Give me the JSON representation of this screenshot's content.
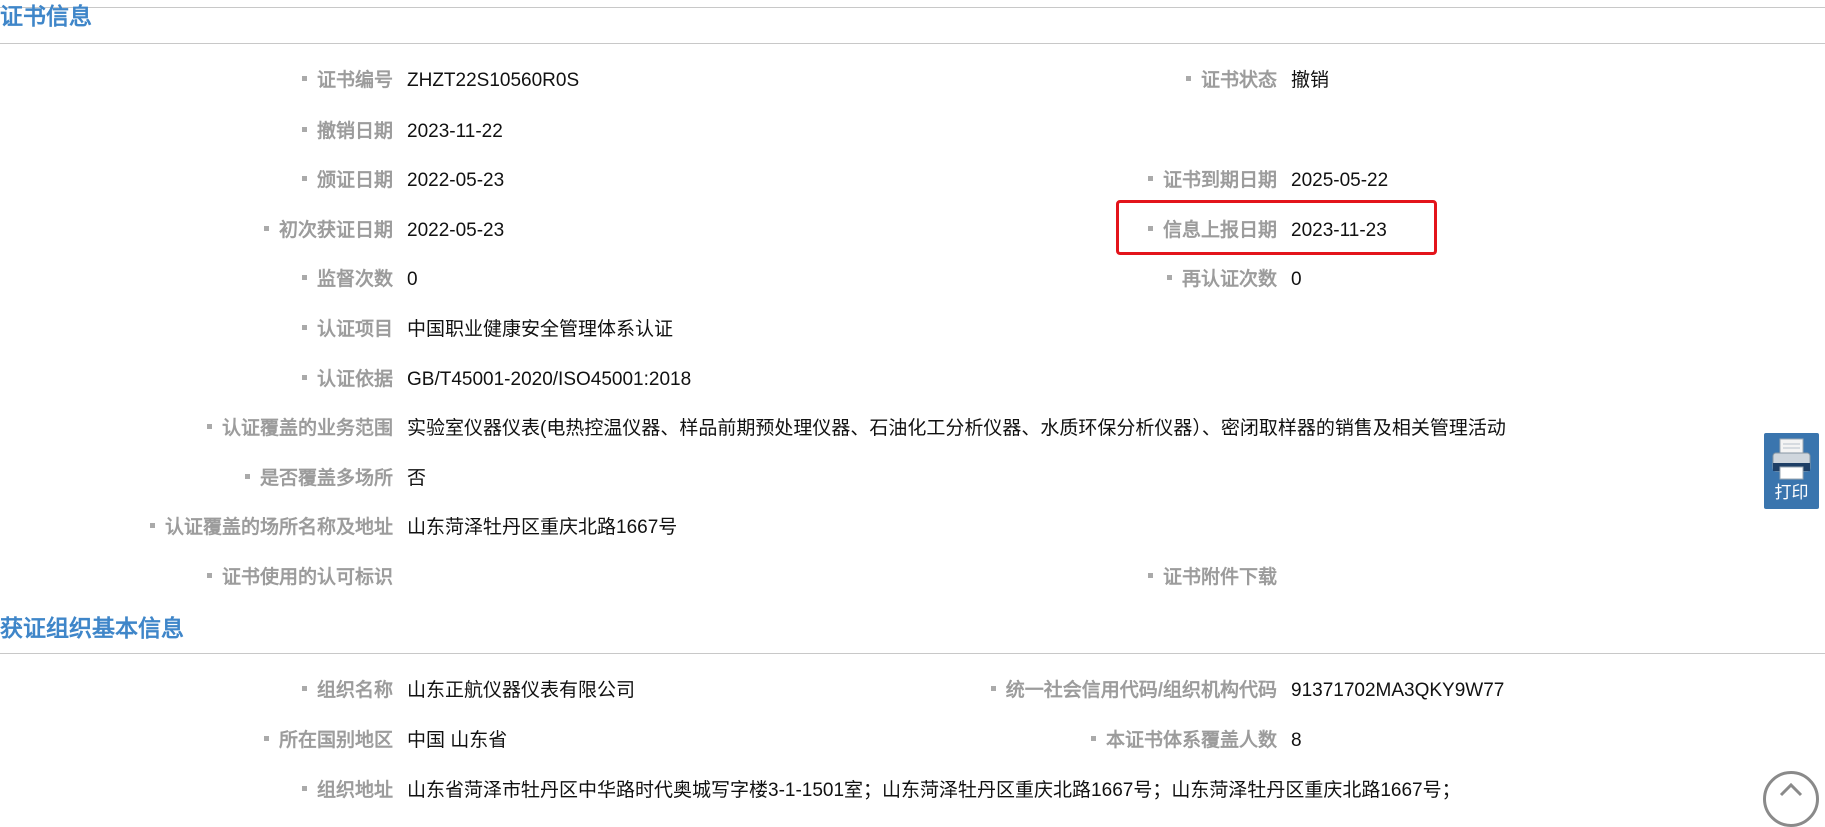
{
  "sections": [
    {
      "title": "证书信息"
    },
    {
      "title": "获证组织基本信息"
    }
  ],
  "cert": {
    "cert_no": {
      "label": "证书编号",
      "value": "ZHZT22S10560R0S"
    },
    "status": {
      "label": "证书状态",
      "value": "撤销"
    },
    "revoke_date": {
      "label": "撤销日期",
      "value": "2023-11-22"
    },
    "issue_date": {
      "label": "颁证日期",
      "value": "2022-05-23"
    },
    "expiry_date": {
      "label": "证书到期日期",
      "value": "2025-05-22"
    },
    "first_date": {
      "label": "初次获证日期",
      "value": "2022-05-23"
    },
    "report_date": {
      "label": "信息上报日期",
      "value": "2023-11-23"
    },
    "supervision_count": {
      "label": "监督次数",
      "value": "0"
    },
    "recert_count": {
      "label": "再认证次数",
      "value": "0"
    },
    "project": {
      "label": "认证项目",
      "value": "中国职业健康安全管理体系认证"
    },
    "basis": {
      "label": "认证依据",
      "value": "GB/T45001-2020/ISO45001:2018"
    },
    "scope": {
      "label": "认证覆盖的业务范围",
      "value": "实验室仪器仪表(电热控温仪器、样品前期预处理仪器、石油化工分析仪器、水质环保分析仪器）、密闭取样器的销售及相关管理活动"
    },
    "multi_site": {
      "label": "是否覆盖多场所",
      "value": "否"
    },
    "site_address": {
      "label": "认证覆盖的场所名称及地址",
      "value": "山东菏泽牡丹区重庆北路1667号"
    },
    "mark": {
      "label": "证书使用的认可标识",
      "value": ""
    },
    "attachment": {
      "label": "证书附件下载",
      "value": ""
    }
  },
  "org": {
    "name": {
      "label": "组织名称",
      "value": "山东正航仪器仪表有限公司"
    },
    "credit_code": {
      "label": "统一社会信用代码/组织机构代码",
      "value": "91371702MA3QKY9W77"
    },
    "region": {
      "label": "所在国别地区",
      "value": "中国 山东省"
    },
    "covered_count": {
      "label": "本证书体系覆盖人数",
      "value": "8"
    },
    "address": {
      "label": "组织地址",
      "value": "山东省菏泽市牡丹区中华路时代奥城写字楼3-1-1501室；山东菏泽牡丹区重庆北路1667号；山东菏泽牡丹区重庆北路1667号；"
    }
  },
  "actions": {
    "print_label": "打印",
    "print_icon": "printer-icon",
    "scroll_top_icon": "chevron-up-icon"
  },
  "colors": {
    "section_title": "#3f86c9",
    "highlight_border": "#e3141b",
    "print_button_bg": "#3a75ae",
    "label_text": "#9c9c9c"
  }
}
